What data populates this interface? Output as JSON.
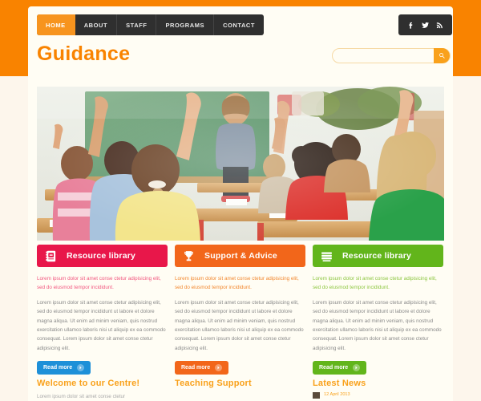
{
  "site": {
    "logo": "Guidance",
    "accent_orange": "#f98300",
    "band_color": "#f98300",
    "panel_color": "#fffdf4"
  },
  "nav": {
    "items": [
      {
        "label": "HOME",
        "active": true
      },
      {
        "label": "ABOUT",
        "active": false
      },
      {
        "label": "STAFF",
        "active": false
      },
      {
        "label": "PROGRAMS",
        "active": false
      },
      {
        "label": "CONTACT",
        "active": false
      }
    ]
  },
  "social": {
    "items": [
      {
        "name": "facebook-icon",
        "label": "Facebook"
      },
      {
        "name": "twitter-icon",
        "label": "Twitter"
      },
      {
        "name": "rss-icon",
        "label": "RSS"
      }
    ]
  },
  "search": {
    "value": "",
    "placeholder": "",
    "button_icon": "search-icon",
    "button_color": "#f9a11b"
  },
  "hero": {
    "alt": "Classroom of students raising hands with teacher at chalkboard"
  },
  "features": [
    {
      "title": "Resource library",
      "icon": "notebook-icon",
      "color": "#e8174a",
      "button_color": "#1e90d8",
      "lead_color": "#f2567f",
      "lead": "Lorem ipsum dolor sit amet conse ctetur adipisicing elit, sed do eiusmod tempor incididunt.",
      "body": "Lorem ipsum dolor sit amet conse ctetur adipisicing elit, sed do eiusmod tempor incididunt ut labore et dolore magna aliqua. Ut enim ad minim veniam, quis nostrud exercitation ullamco laboris nisi ut aliquip ex ea commodo consequat. Lorem ipsum dolor sit amet conse ctetur adipisicing elit.",
      "button_label": "Read more"
    },
    {
      "title": "Support & Advice",
      "icon": "trophy-icon",
      "color": "#f2661a",
      "button_color": "#f2661a",
      "lead_color": "#f2872e",
      "lead": "Lorem ipsum dolor sit amet conse ctetur adipisicing elit, sed do eiusmod tempor incididunt.",
      "body": "Lorem ipsum dolor sit amet conse ctetur adipisicing elit, sed do eiusmod tempor incididunt ut labore et dolore magna aliqua. Ut enim ad minim veniam, quis nostrud exercitation ullamco laboris nisi ut aliquip ex ea commodo consequat. Lorem ipsum dolor sit amet conse ctetur adipisicing elit.",
      "button_label": "Read more"
    },
    {
      "title": "Resource library",
      "icon": "books-stack-icon",
      "color": "#62b51b",
      "button_color": "#62b51b",
      "lead_color": "#8cc63f",
      "lead": "Lorem ipsum dolor sit amet conse ctetur adipisicing elit, sed do eiusmod tempor incididunt.",
      "body": "Lorem ipsum dolor sit amet conse ctetur adipisicing elit, sed do eiusmod tempor incididunt ut labore et dolore magna aliqua. Ut enim ad minim veniam, quis nostrud exercitation ullamco laboris nisi ut aliquip ex ea commodo consequat. Lorem ipsum dolor sit amet conse ctetur adipisicing elit.",
      "button_label": "Read more"
    }
  ],
  "bottom_sections": [
    {
      "title": "Welcome to our Centre!",
      "snippet": "Lorem ipsum dolor sit amet conse ctetur"
    },
    {
      "title": "Teaching Support",
      "snippet": ""
    },
    {
      "title": "Latest News",
      "snippet": "",
      "news_date": "12 April 2013"
    }
  ]
}
